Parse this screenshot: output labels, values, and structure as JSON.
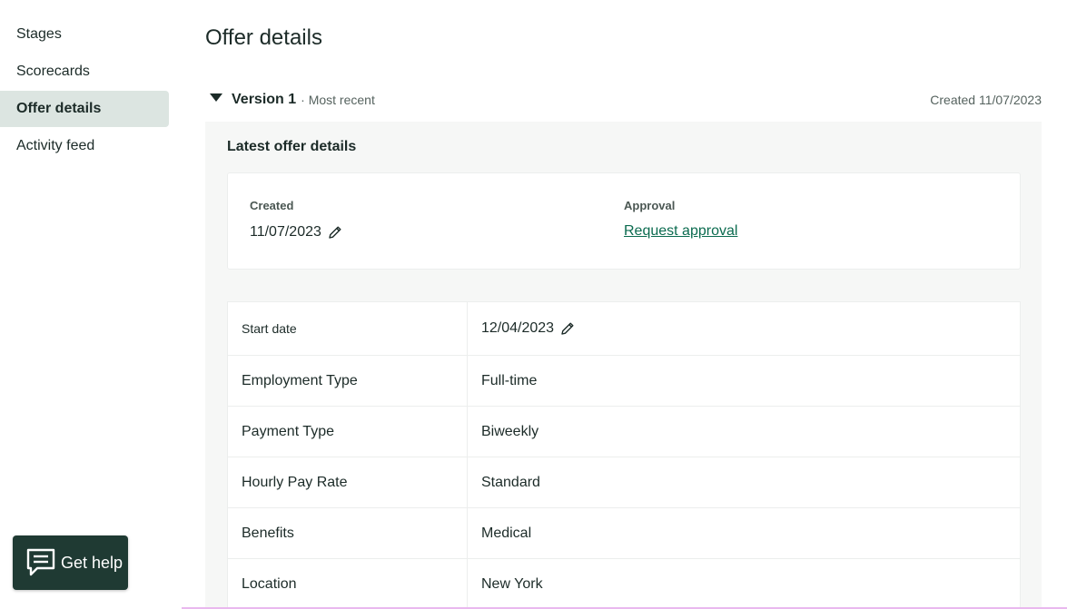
{
  "sidebar": {
    "items": [
      {
        "label": "Stages",
        "active": false
      },
      {
        "label": "Scorecards",
        "active": false
      },
      {
        "label": "Offer details",
        "active": true
      },
      {
        "label": "Activity feed",
        "active": false
      }
    ]
  },
  "main": {
    "title": "Offer details",
    "version": {
      "label": "Version 1",
      "meta": "· Most recent",
      "created": "Created 11/07/2023"
    },
    "panel": {
      "heading": "Latest offer details",
      "summary": {
        "created_label": "Created",
        "created_value": "11/07/2023",
        "approval_label": "Approval",
        "approval_link": "Request approval"
      },
      "details": [
        {
          "key": "Start date",
          "value": "12/04/2023"
        },
        {
          "key": "Employment Type",
          "value": "Full-time"
        },
        {
          "key": "Payment Type",
          "value": "Biweekly"
        },
        {
          "key": "Hourly Pay Rate",
          "value": "Standard"
        },
        {
          "key": "Benefits",
          "value": "Medical"
        },
        {
          "key": "Location",
          "value": "New York"
        }
      ]
    }
  },
  "help": {
    "label": "Get help",
    "icon": "chat-icon"
  },
  "colors": {
    "accent_link": "#0b6b4f",
    "help_bg": "#1f3a33",
    "active_nav_bg": "#dce5e1"
  }
}
